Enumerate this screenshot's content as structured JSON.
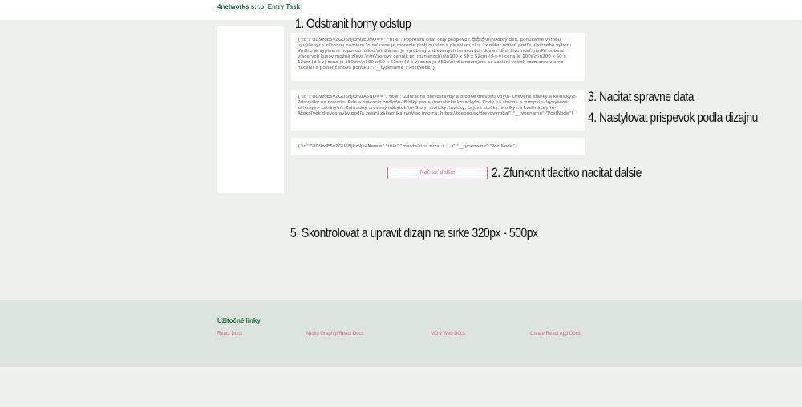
{
  "header": {
    "brand": "4networks s.r.o. Entry Task"
  },
  "posts": [
    {
      "text": "{\"id\":\"UG9zdE5vZGU6NjkzNzE0MQ==\",\"title\":\"Poprosím čítať celý príspevok.😎😎😎\\n\\nDobrý deň, ponúkame výrobu vyvýšených záhonov namieru.\\n\\nV cene je morenie proti hubám a plesniam plus 2x náter odtieň podľa vlastného výberu. Vnútro je vyplnené nopovou fóliou.\\n\\nZáhon je vyrobený z drevených terasových dosiek dĺhá životnosť.\\n\\nPri odbere viacerých kusov možná zľava.\\n\\nVzorový cenník pri rozmeroch\\n\\n100 x 50 x 52cm (d-š-v) cena je 100e\\n\\n200 x 50 x 52cm (d-š-v) cena je 180e\\n\\n300 x 50 x 52cm (d-š-v) cena je 250e\\n\\nSamozrejme po zaslaní vašich rozmerov vieme naceniť a poslať cenovú ponuku.\",\"__typename\":\"PostNode\"}"
    },
    {
      "text": "{\"id\":\"UG9zdE5vZGU6NjkzNzA5NQ==\",\"title\":\"Záhradné drevostavby a drobné drevostavby\\n- Drevené stánky a kôlničky\\n- Prístrešky na drevo\\n- Psie a mačacie búdky\\n- Búdky pre automatické kosačky\\n- Kryty na studne a žumpy\\n- Vyvýšené záhony\\n- Latríny\\n\\nZáhradný drevený nábytok:\\n- Stoly, stoličky, lavičky, čajové stolíky, stoliky na kvetináče\\n\\n- Akékoľvek drevostavby podľa želaní zákazníka\\n\\nViac info na: https://teeboo.sk/drevovyroba/\",\"__typename\":\"PostNode\"}"
    },
    {
      "text": "{\"id\":\"UG9zdE5vZGU6NjkzNjk4Nw==\",\"title\":\"manželkina ruža :) :) :)\",\"__typename\":\"PostNode\"}"
    }
  ],
  "load_more_label": "Načítať ďalšie",
  "notes": {
    "n1": "1. Odstranit horny odstup",
    "n2": "2. Zfunkcnit tlacitko nacitat dalsie",
    "n3": "3. Nacitat spravne data",
    "n4": "4. Nastylovat prispevok podla dizajnu",
    "n5": "5. Skontrolovat a upravit dizajn na sirke 320px - 500px"
  },
  "footer": {
    "title": "Užitočné linky",
    "links": [
      "React Docs",
      "Apollo Graphql React Docs",
      "MDN Web Docs",
      "Create React App Docs"
    ]
  },
  "colors": {
    "brand": "#1f6b3c",
    "accent": "#e0638a",
    "footer_bg": "#dbe4dd",
    "page_bg": "#eef0ee"
  }
}
